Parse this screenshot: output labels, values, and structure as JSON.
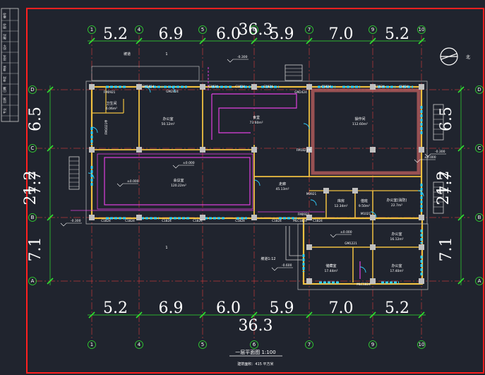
{
  "drawing": {
    "title": "一层平面图 1:100",
    "subtitle": "建筑面积：415 平方米",
    "overall_width_top": "36.3",
    "overall_width_bottom": "36.3",
    "overall_depth_left": "21.2",
    "overall_depth_right": "21.2",
    "north_label": "北"
  },
  "grid_x": [
    "1",
    "4",
    "5",
    "6",
    "7",
    "9",
    "10"
  ],
  "grid_y": [
    "D",
    "C",
    "B",
    "A"
  ],
  "bay_dims_x": [
    "5.2",
    "6.9",
    "6.0",
    "5.9",
    "7.0",
    "5.2"
  ],
  "bay_dims_y": [
    "6.5",
    "7.7",
    "7.1"
  ],
  "rooms": [
    {
      "name": "卫生间",
      "area": "6.06m²"
    },
    {
      "name": "办公室",
      "area": "50.12m²"
    },
    {
      "name": "食堂",
      "area": "73.60m²"
    },
    {
      "name": "操作间",
      "area": "112.60m²"
    },
    {
      "name": "会议室",
      "area": "120.22m²"
    },
    {
      "name": "走廊",
      "area": "45.13m²"
    },
    {
      "name": "库房",
      "area": "12.34m²"
    },
    {
      "name": "值班",
      "area": "9.50m²"
    },
    {
      "name": "办公室(消防)",
      "area": "22.7m²"
    },
    {
      "name": "办公室",
      "area": "16.12m²"
    },
    {
      "name": "储藏室",
      "area": "17.44m²"
    },
    {
      "name": "办公室",
      "area": "17.40m²"
    }
  ],
  "door_labels": [
    "FM0921",
    "SM1824",
    "GM2424",
    "C1824",
    "C1824",
    "C1824",
    "GM2424",
    "C1824",
    "C1824",
    "C1824",
    "FM1021甲",
    "FM1821甲",
    "C1824",
    "C1824",
    "C1824",
    "C1824",
    "C1824",
    "C1824",
    "C1824",
    "M0921",
    "M1021",
    "FM0921",
    "MLC1824",
    "GM1221",
    "MLC1824"
  ],
  "elevations": [
    "-0.300",
    "±0.000",
    "-0.300",
    "±0.000",
    "-0.300",
    "-0.600",
    "±0.000",
    "±0.000"
  ],
  "annotations": [
    "坡道",
    "坡道1:12",
    "1",
    "1"
  ],
  "margin_labels": [
    "编号",
    "图号",
    "建设",
    "设计",
    "校对",
    "审核",
    "审定",
    "日期",
    "比例",
    "专业"
  ],
  "colors": {
    "frame": "#ff2020",
    "wall": "#f0c040",
    "axis": "#ff4040",
    "dim": "#30e030",
    "window": "#30d0ff",
    "column": "#c0c0c0",
    "hatch": "#e040e0",
    "text": "#ffffff"
  }
}
